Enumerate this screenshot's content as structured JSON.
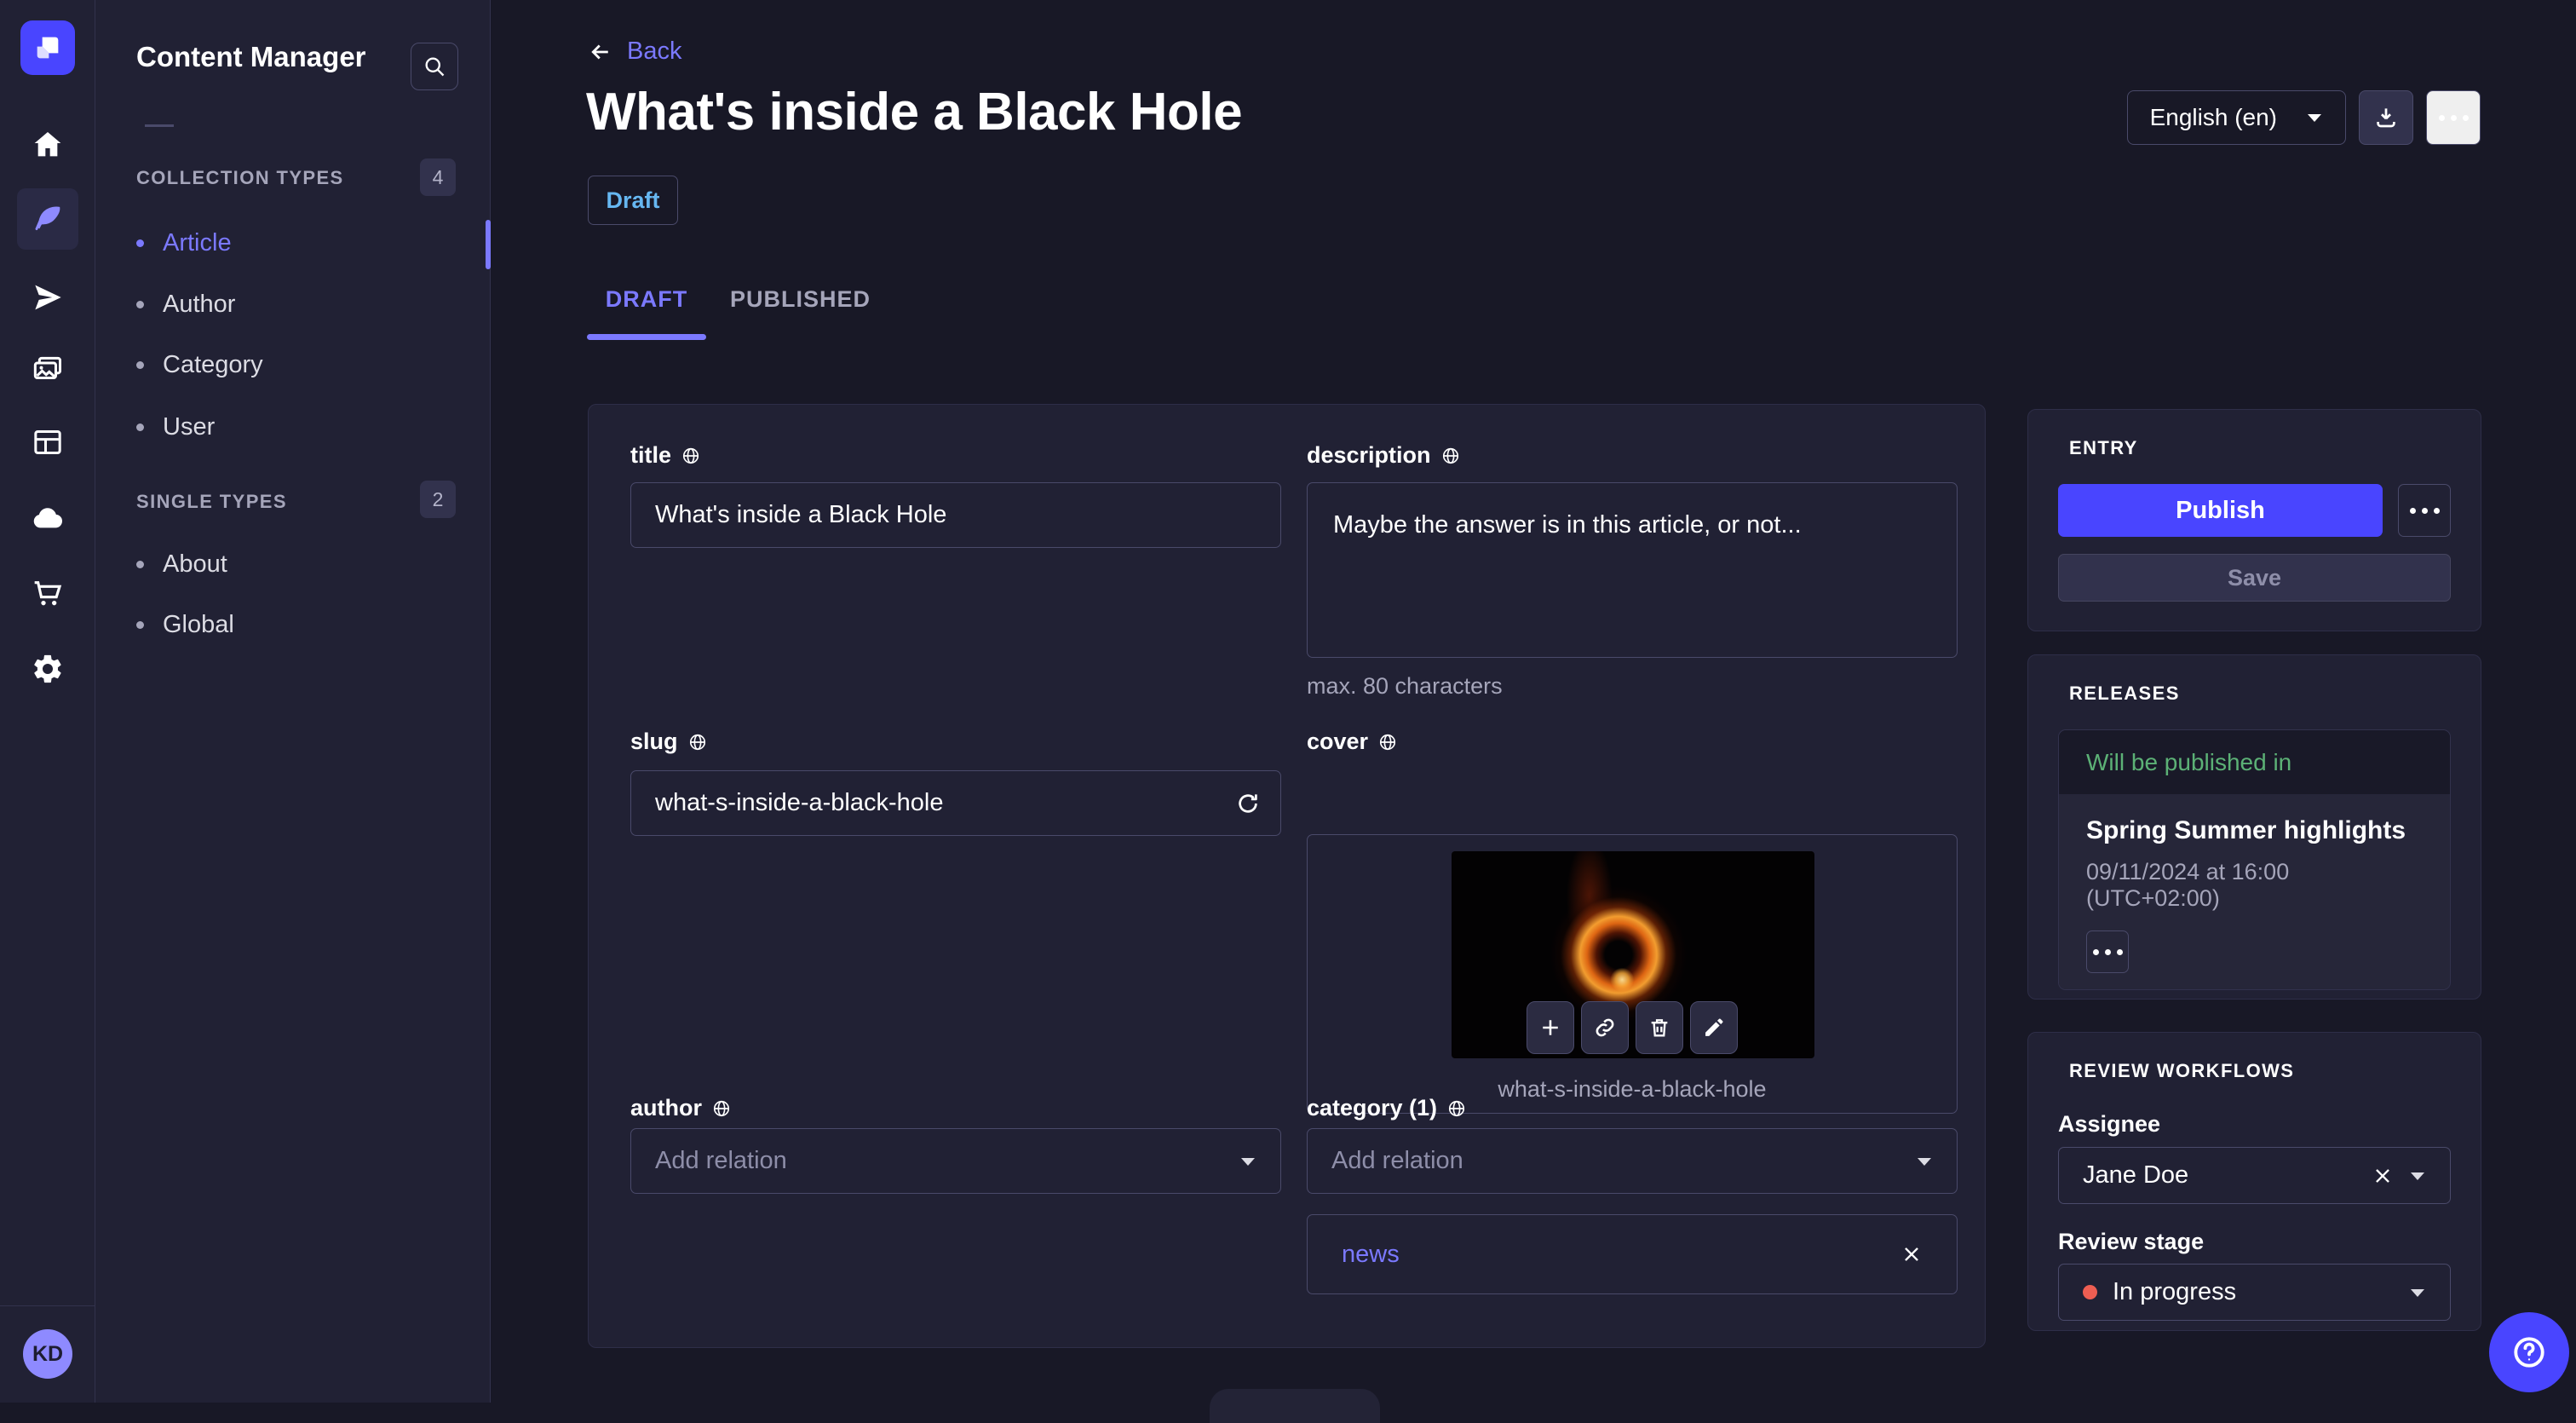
{
  "colors": {
    "background": "#181826",
    "surface": "#212134",
    "border": "#32324d",
    "input_border": "#4a4a6a",
    "accent": "#4945ff",
    "accent_light": "#7b79ff",
    "draft_blue": "#66b7f1",
    "success_green": "#5cb176",
    "danger_red": "#ee5e52",
    "muted_text": "#a5a5ba"
  },
  "rail": {
    "avatar_initials": "KD"
  },
  "sidebar": {
    "title": "Content Manager",
    "sections": [
      {
        "label": "COLLECTION TYPES",
        "count": "4",
        "items": [
          {
            "label": "Article"
          },
          {
            "label": "Author"
          },
          {
            "label": "Category"
          },
          {
            "label": "User"
          }
        ]
      },
      {
        "label": "SINGLE TYPES",
        "count": "2",
        "items": [
          {
            "label": "About"
          },
          {
            "label": "Global"
          }
        ]
      }
    ]
  },
  "header": {
    "back_label": "Back",
    "title": "What's inside a Black Hole",
    "status": "Draft",
    "tabs": {
      "draft": "DRAFT",
      "published": "PUBLISHED"
    },
    "locale": "English (en)"
  },
  "form": {
    "title": {
      "label": "title",
      "value": "What's inside a Black Hole"
    },
    "description": {
      "label": "description",
      "value": "Maybe the answer is in this article, or not...",
      "hint": "max. 80 characters"
    },
    "slug": {
      "label": "slug",
      "value": "what-s-inside-a-black-hole"
    },
    "cover": {
      "label": "cover",
      "caption": "what-s-inside-a-black-hole"
    },
    "author": {
      "label": "author",
      "placeholder": "Add relation"
    },
    "category": {
      "label": "category (1)",
      "placeholder": "Add relation",
      "relation": "news"
    }
  },
  "entry": {
    "label": "ENTRY",
    "publish_label": "Publish",
    "save_label": "Save"
  },
  "releases": {
    "label": "RELEASES",
    "status": "Will be published in",
    "release_title": "Spring Summer highlights",
    "release_date": "09/11/2024 at 16:00 (UTC+02:00)"
  },
  "review": {
    "label": "REVIEW WORKFLOWS",
    "assignee_label": "Assignee",
    "assignee_value": "Jane Doe",
    "stage_label": "Review stage",
    "stage_value": "In progress"
  }
}
